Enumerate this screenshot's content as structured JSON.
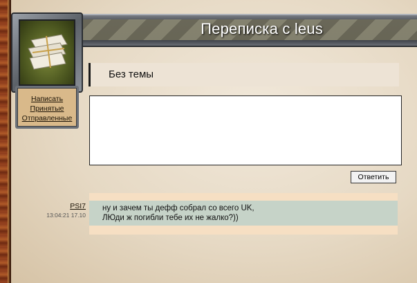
{
  "header": {
    "title": "Переписка с leus"
  },
  "sidebar": {
    "links": [
      "Написать",
      "Принятые",
      "Отправленные"
    ]
  },
  "thread": {
    "subject": "Без темы"
  },
  "reply": {
    "button_label": "Ответить",
    "value": ""
  },
  "messages": [
    {
      "author": "PSI7",
      "time": "13:04:21 17.10",
      "lines": [
        "ну и зачем ты дефф собрал со всего UK,",
        "ЛЮди ж погибли тебе их не жалко?))"
      ]
    }
  ],
  "colors": {
    "paper": "#e7dccb",
    "subject_bg": "#ede3d5",
    "message_outer": "#f6dfc3",
    "message_inner": "#c6d3c8",
    "menu_bg": "#d9b98a"
  }
}
